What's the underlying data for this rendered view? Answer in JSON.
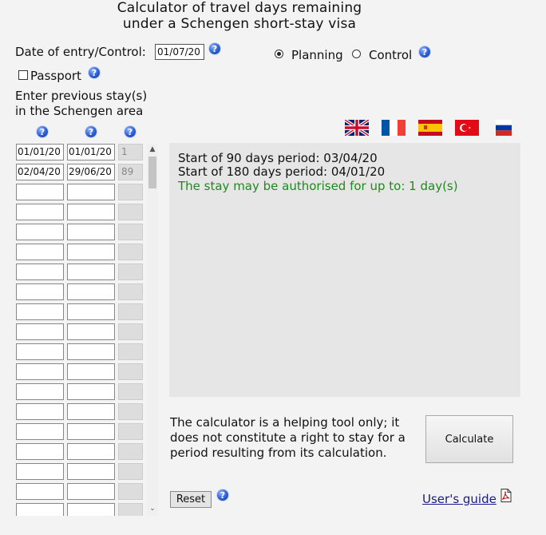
{
  "title": {
    "line1": "Calculator of travel days remaining",
    "line2": "under a Schengen short-stay visa"
  },
  "entry": {
    "label": "Date of entry/Control:",
    "value": "01/07/20"
  },
  "mode": {
    "planning_label": "Planning",
    "control_label": "Control",
    "selected": "Planning"
  },
  "passport": {
    "label": "Passport",
    "checked": false
  },
  "stays_heading": {
    "line1": "Enter previous stay(s)",
    "line2": "in the Schengen area"
  },
  "help_glyph": "?",
  "flags": [
    "uk-flag-icon",
    "france-flag-icon",
    "spain-flag-icon",
    "turkey-flag-icon",
    "russia-flag-icon"
  ],
  "stays": [
    {
      "from": "01/01/20",
      "to": "01/01/20",
      "days": "1"
    },
    {
      "from": "02/04/20",
      "to": "29/06/20",
      "days": "89"
    },
    {
      "from": "",
      "to": "",
      "days": ""
    },
    {
      "from": "",
      "to": "",
      "days": ""
    },
    {
      "from": "",
      "to": "",
      "days": ""
    },
    {
      "from": "",
      "to": "",
      "days": ""
    },
    {
      "from": "",
      "to": "",
      "days": ""
    },
    {
      "from": "",
      "to": "",
      "days": ""
    },
    {
      "from": "",
      "to": "",
      "days": ""
    },
    {
      "from": "",
      "to": "",
      "days": ""
    },
    {
      "from": "",
      "to": "",
      "days": ""
    },
    {
      "from": "",
      "to": "",
      "days": ""
    },
    {
      "from": "",
      "to": "",
      "days": ""
    },
    {
      "from": "",
      "to": "",
      "days": ""
    },
    {
      "from": "",
      "to": "",
      "days": ""
    },
    {
      "from": "",
      "to": "",
      "days": ""
    },
    {
      "from": "",
      "to": "",
      "days": ""
    },
    {
      "from": "",
      "to": "",
      "days": ""
    },
    {
      "from": "",
      "to": "",
      "days": ""
    }
  ],
  "result": {
    "line1": "Start of 90 days period: 03/04/20",
    "line2": "Start of 180 days period: 04/01/20",
    "line3": "The stay may be authorised for up to: 1 day(s)"
  },
  "disclaimer": "The calculator is a helping tool only; it does not constitute a right to stay for a period resulting from its calculation.",
  "buttons": {
    "calculate": "Calculate",
    "reset": "Reset"
  },
  "guide_link": "User's guide",
  "colors": {
    "help_blue": "#2d5fd1",
    "result_green": "#1f8a1f",
    "link_blue": "#1a1a8c"
  }
}
